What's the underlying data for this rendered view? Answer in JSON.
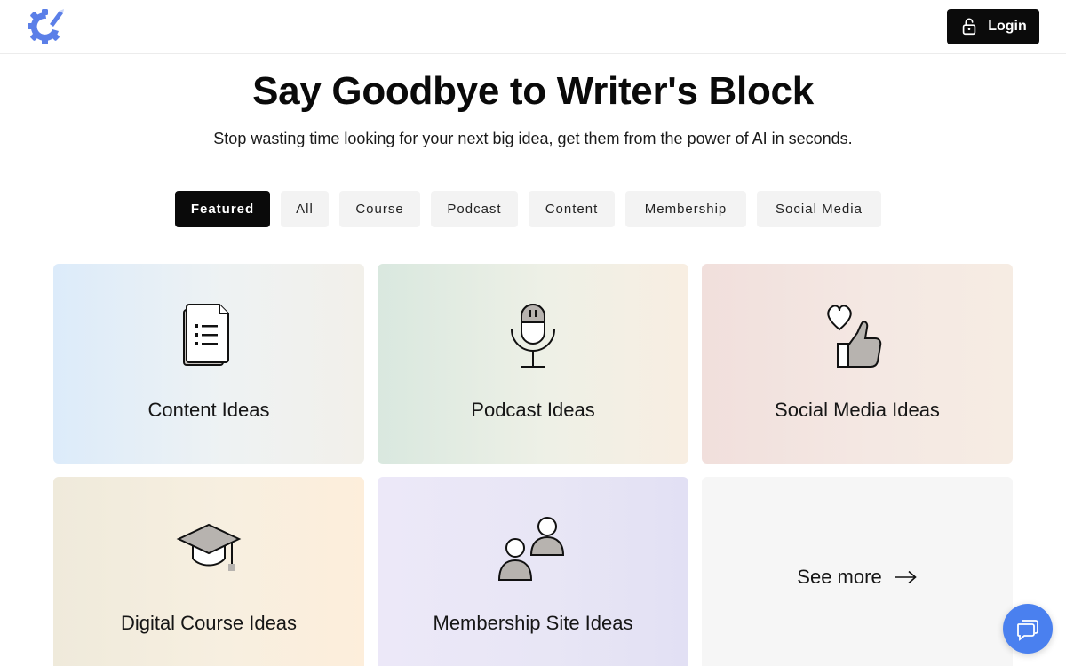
{
  "header": {
    "logo_icon": "gear-pencil-logo",
    "login_label": "Login",
    "login_icon": "lock-open-icon"
  },
  "hero": {
    "title": "Say Goodbye to Writer's Block",
    "subtitle": "Stop wasting time looking for your next big idea, get them from the power of AI in seconds."
  },
  "tabs": [
    {
      "label": "Featured",
      "active": true
    },
    {
      "label": "All",
      "active": false
    },
    {
      "label": "Course",
      "active": false
    },
    {
      "label": "Podcast",
      "active": false
    },
    {
      "label": "Content",
      "active": false
    },
    {
      "label": "Membership",
      "active": false
    },
    {
      "label": "Social Media",
      "active": false
    }
  ],
  "cards": [
    {
      "label": "Content Ideas",
      "icon": "document-list-icon"
    },
    {
      "label": "Podcast Ideas",
      "icon": "microphone-icon"
    },
    {
      "label": "Social Media Ideas",
      "icon": "heart-thumbs-up-icon"
    },
    {
      "label": "Digital Course Ideas",
      "icon": "graduation-cap-icon"
    },
    {
      "label": "Membership Site Ideas",
      "icon": "users-icon"
    }
  ],
  "see_more": {
    "label": "See more",
    "icon": "arrow-right-icon"
  },
  "chat": {
    "icon": "chat-bubbles-icon"
  },
  "colors": {
    "accent": "#4a80ef",
    "logo": "#5b7fe8",
    "dark": "#0a0a0a"
  }
}
